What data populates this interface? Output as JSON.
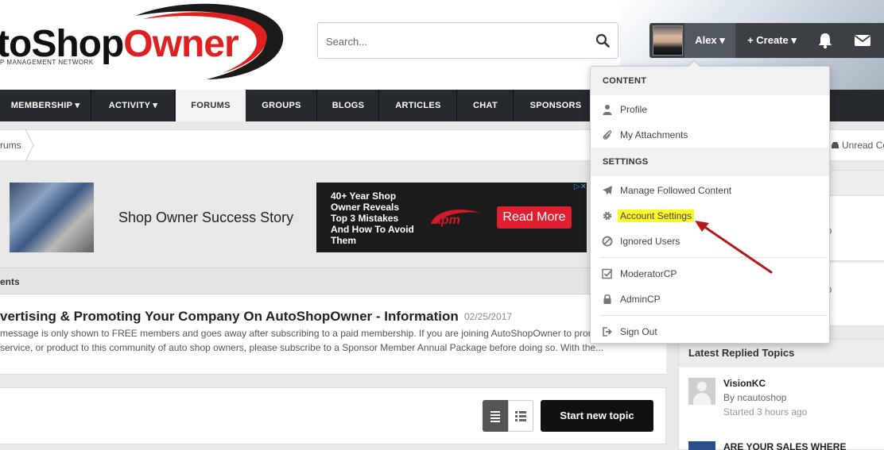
{
  "logo": {
    "text_dark": "to",
    "text_shop": "Shop",
    "text_red": "Owner",
    "tagline": "P MANAGEMENT NETWORK"
  },
  "search": {
    "placeholder": "Search..."
  },
  "user": {
    "name": "Alex ▾",
    "create": "+ Create ▾"
  },
  "nav": {
    "items": [
      {
        "label": "MEMBERSHIP ▾"
      },
      {
        "label": "ACTIVITY ▾"
      },
      {
        "label": "FORUMS"
      },
      {
        "label": "GROUPS"
      },
      {
        "label": "BLOGS"
      },
      {
        "label": "ARTICLES"
      },
      {
        "label": "CHAT"
      },
      {
        "label": "SPONSORS"
      }
    ]
  },
  "breadcrumb": {
    "current": "rums",
    "unread": "Unread Co"
  },
  "ad": {
    "headline": "Shop Owner Success Story",
    "copy": "40+ Year Shop Owner Reveals Top 3 Mistakes And How To Avoid Them",
    "logo_text": "apm",
    "cta": "Read More",
    "choices": "▷✕"
  },
  "announcements": {
    "header": "ents",
    "title": "vertising & Promoting Your Company On AutoShopOwner - Information",
    "date": "02/25/2017",
    "text": "message is only shown to FREE members and goes away after subscribing to a paid membership. If you are joining AutoShopOwner to prom ness, service, or product to this community of auto shop owners, please subscribe to a Sponsor Member Annual Package before doing so. With the..."
  },
  "toolbar": {
    "new_topic": "Start new topic"
  },
  "sidebar": {
    "num1": "0",
    "num2": "0",
    "latest_header": "Latest Replied Topics",
    "topics": [
      {
        "title": "VisionKC",
        "by": "By ncautoshop",
        "time": "Started 3 hours ago"
      },
      {
        "title": "ARE YOUR SALES WHERE",
        "by": "",
        "time": ""
      }
    ]
  },
  "dropdown": {
    "content_label": "CONTENT",
    "profile": "Profile",
    "attachments": "My Attachments",
    "settings_label": "SETTINGS",
    "followed": "Manage Followed Content",
    "account": "Account Settings",
    "ignored": "Ignored Users",
    "modcp": "ModeratorCP",
    "admincp": "AdminCP",
    "signout": "Sign Out"
  },
  "colors": {
    "accent_red": "#e02020",
    "nav_bg": "#26292d",
    "highlight": "#fbf72a",
    "annotation_arrow": "#b21a1a"
  }
}
